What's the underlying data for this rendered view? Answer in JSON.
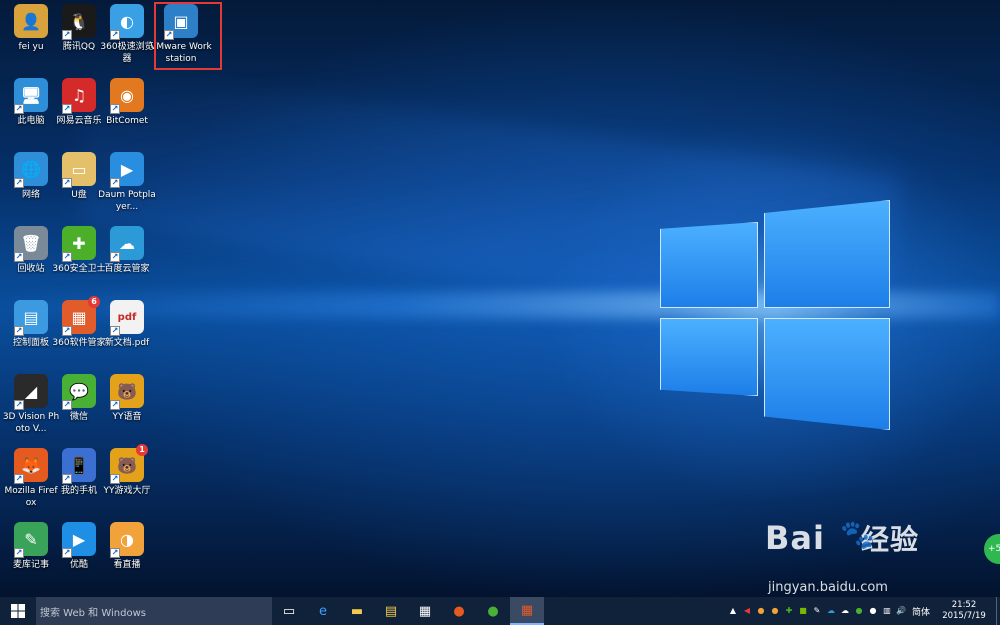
{
  "desktop": {
    "icons": [
      {
        "label": "fei yu",
        "icon": "user-folder-icon",
        "color": "#d8a23c",
        "glyph": "👤"
      },
      {
        "label": "腾讯QQ",
        "icon": "qq-penguin-icon",
        "color": "#1a1a1a",
        "glyph": "🐧"
      },
      {
        "label": "360极速浏览器",
        "icon": "360-browser-icon",
        "color": "#3aa0e6",
        "glyph": "◐"
      },
      {
        "label": "VMware Workstation",
        "icon": "vmware-icon",
        "color": "#2d7fc8",
        "glyph": "▣"
      },
      {
        "label": "此电脑",
        "icon": "this-pc-icon",
        "color": "#2f8ed8",
        "glyph": "🖥"
      },
      {
        "label": "网易云音乐",
        "icon": "netease-music-icon",
        "color": "#d42a2a",
        "glyph": "♫"
      },
      {
        "label": "BitComet",
        "icon": "bitcomet-icon",
        "color": "#e2781f",
        "glyph": "◉"
      },
      {
        "label": "网络",
        "icon": "network-icon",
        "color": "#2f8ed8",
        "glyph": "🌐"
      },
      {
        "label": "U盘",
        "icon": "usb-folder-icon",
        "color": "#e4c06a",
        "glyph": "▭"
      },
      {
        "label": "Daum Potplayer...",
        "icon": "potplayer-icon",
        "color": "#2a8ee0",
        "glyph": "▶"
      },
      {
        "label": "回收站",
        "icon": "recycle-bin-icon",
        "color": "#7a8a99",
        "glyph": "🗑"
      },
      {
        "label": "360安全卫士",
        "icon": "360-security-icon",
        "color": "#4caf2a",
        "glyph": "✚"
      },
      {
        "label": "百度云管家",
        "icon": "baidu-cloud-icon",
        "color": "#2d9ad8",
        "glyph": "☁"
      },
      {
        "label": "控制面板",
        "icon": "control-panel-icon",
        "color": "#3c9be0",
        "glyph": "▤"
      },
      {
        "label": "360软件管家",
        "icon": "360-software-icon",
        "color": "#e25b2b",
        "glyph": "▦",
        "badge": "6"
      },
      {
        "label": "新文档.pdf",
        "icon": "pdf-file-icon",
        "color": "#f2f2f2",
        "glyph": "pdf"
      },
      {
        "label": "3D Vision Photo V...",
        "icon": "3d-vision-icon",
        "color": "#2a2a2a",
        "glyph": "◢"
      },
      {
        "label": "微信",
        "icon": "wechat-icon",
        "color": "#48b035",
        "glyph": "💬"
      },
      {
        "label": "YY语音",
        "icon": "yy-voice-icon",
        "color": "#e4a21a",
        "glyph": "🐻"
      },
      {
        "label": "Mozilla Firefox",
        "icon": "firefox-icon",
        "color": "#e45a1f",
        "glyph": "🦊"
      },
      {
        "label": "我的手机",
        "icon": "my-phone-icon",
        "color": "#3b6fd1",
        "glyph": "📱"
      },
      {
        "label": "YY游戏大厅",
        "icon": "yy-game-icon",
        "color": "#e4a21a",
        "glyph": "🐻",
        "badge": "1"
      },
      {
        "label": "麦库记事",
        "icon": "maiku-notes-icon",
        "color": "#3aa35a",
        "glyph": "✎"
      },
      {
        "label": "优酷",
        "icon": "youku-icon",
        "color": "#1f8fe6",
        "glyph": "▶"
      },
      {
        "label": "看直播",
        "icon": "live-stream-icon",
        "color": "#f2a23a",
        "glyph": "◑"
      }
    ]
  },
  "taskbar": {
    "search_placeholder": "搜索 Web 和 Windows",
    "pinned": [
      {
        "name": "task-view-icon",
        "glyph": "▭",
        "color": "#ffffff"
      },
      {
        "name": "edge-icon",
        "glyph": "e",
        "color": "#3aa0ff"
      },
      {
        "name": "explorer-icon",
        "glyph": "▬",
        "color": "#f2c94c"
      },
      {
        "name": "file-explorer-icon",
        "glyph": "▤",
        "color": "#f2c94c"
      },
      {
        "name": "store-icon",
        "glyph": "▦",
        "color": "#ffffff"
      },
      {
        "name": "firefox-icon",
        "glyph": "●",
        "color": "#e45a1f"
      },
      {
        "name": "wechat-icon",
        "glyph": "●",
        "color": "#48b035"
      },
      {
        "name": "360-software-icon",
        "glyph": "▦",
        "color": "#e25b2b"
      }
    ],
    "tray_icons": [
      {
        "name": "show-hidden-icon",
        "glyph": "▲",
        "color": "#ffffff"
      },
      {
        "name": "tray-red-icon",
        "glyph": "◀",
        "color": "#e53935"
      },
      {
        "name": "tray-orange-icon",
        "glyph": "●",
        "color": "#f2a23a"
      },
      {
        "name": "tray-game-icon",
        "glyph": "●",
        "color": "#f2a23a"
      },
      {
        "name": "tray-360-icon",
        "glyph": "✚",
        "color": "#4caf2a"
      },
      {
        "name": "tray-nvidia-icon",
        "glyph": "■",
        "color": "#76b900"
      },
      {
        "name": "tray-note-icon",
        "glyph": "✎",
        "color": "#ffffff"
      },
      {
        "name": "tray-cloud-icon",
        "glyph": "☁",
        "color": "#2d9ad8"
      },
      {
        "name": "tray-cloud2-icon",
        "glyph": "☁",
        "color": "#ffffff"
      },
      {
        "name": "tray-wechat-icon",
        "glyph": "●",
        "color": "#48b035"
      },
      {
        "name": "tray-qq-icon",
        "glyph": "●",
        "color": "#ffffff"
      },
      {
        "name": "tray-network-icon",
        "glyph": "▥",
        "color": "#ffffff"
      },
      {
        "name": "tray-volume-icon",
        "glyph": "🔊",
        "color": "#ffffff"
      }
    ],
    "ime": "简体",
    "time": "21:52",
    "date": "2015/7/19"
  },
  "watermark": {
    "brand": "Bai",
    "brand_suffix": "经验",
    "url": "jingyan.baidu.com"
  },
  "fab_label": "+5"
}
